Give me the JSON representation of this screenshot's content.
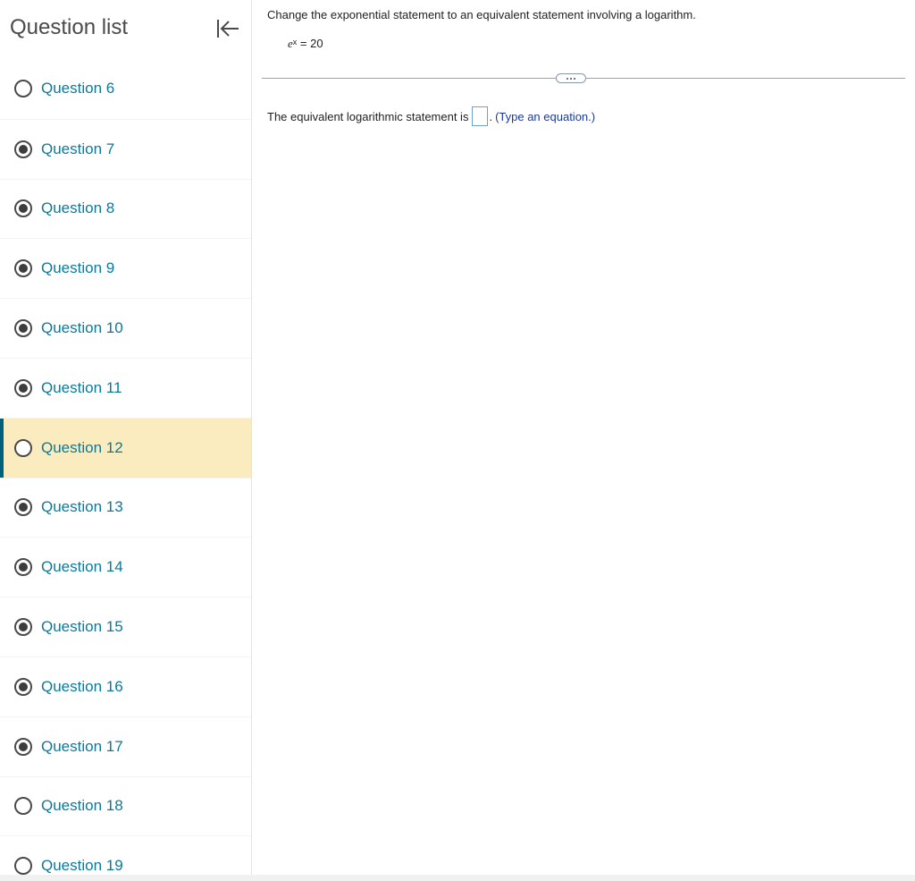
{
  "sidebar": {
    "title": "Question list",
    "collapse_icon": "collapse-left-icon",
    "questions": [
      {
        "label": "Question 6",
        "status": "empty"
      },
      {
        "label": "Question 7",
        "status": "filled"
      },
      {
        "label": "Question 8",
        "status": "filled"
      },
      {
        "label": "Question 9",
        "status": "filled"
      },
      {
        "label": "Question 10",
        "status": "filled"
      },
      {
        "label": "Question 11",
        "status": "filled"
      },
      {
        "label": "Question 12",
        "status": "empty",
        "active": true
      },
      {
        "label": "Question 13",
        "status": "filled"
      },
      {
        "label": "Question 14",
        "status": "filled"
      },
      {
        "label": "Question 15",
        "status": "filled"
      },
      {
        "label": "Question 16",
        "status": "filled"
      },
      {
        "label": "Question 17",
        "status": "filled"
      },
      {
        "label": "Question 18",
        "status": "empty"
      },
      {
        "label": "Question 19",
        "status": "empty"
      }
    ]
  },
  "question": {
    "prompt": "Change the exponential statement to an equivalent statement involving a logarithm.",
    "equation_base": "e",
    "equation_exponent": "x",
    "equation_rest": " = 20",
    "more_icon": "ellipsis-icon",
    "answer_prefix": "The equivalent logarithmic statement is",
    "answer_suffix": ".",
    "answer_hint": "(Type an equation.)",
    "answer_value": ""
  },
  "colors": {
    "accent": "#0b7a9a",
    "active_row": "#faecbe",
    "active_marker": "#00627a",
    "hint": "#1b3a9c"
  }
}
